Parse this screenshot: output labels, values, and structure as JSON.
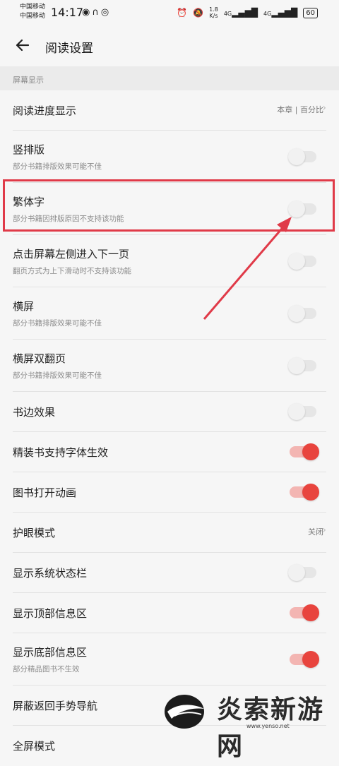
{
  "status_bar": {
    "carrier1": "中国移动",
    "carrier2": "中国移动",
    "time": "14:17",
    "net_speed_value": "1.8",
    "net_speed_unit": "K/s",
    "signal1": "4G",
    "signal2": "4G",
    "battery": "60",
    "left_icons": [
      "weibo-icon",
      "headphones-icon",
      "eye-icon"
    ],
    "right_icons": [
      "alarm-icon",
      "mute-icon"
    ]
  },
  "header": {
    "title": "阅读设置"
  },
  "section": {
    "label": "屏幕显示"
  },
  "rows": [
    {
      "title": "阅读进度显示",
      "value": "本章 | 百分比",
      "type": "nav"
    },
    {
      "title": "竖排版",
      "subtitle": "部分书籍排版效果可能不佳",
      "type": "toggle",
      "on": false
    },
    {
      "title": "繁体字",
      "subtitle": "部分书籍因排版原因不支持该功能",
      "type": "toggle",
      "on": false
    },
    {
      "title": "点击屏幕左侧进入下一页",
      "subtitle": "翻页方式为上下滑动时不支持该功能",
      "type": "toggle",
      "on": false
    },
    {
      "title": "横屏",
      "subtitle": "部分书籍排版效果可能不佳",
      "type": "toggle",
      "on": false
    },
    {
      "title": "横屏双翻页",
      "subtitle": "部分书籍排版效果可能不佳",
      "type": "toggle",
      "on": false
    },
    {
      "title": "书边效果",
      "type": "toggle",
      "on": false
    },
    {
      "title": "精装书支持字体生效",
      "type": "toggle",
      "on": true
    },
    {
      "title": "图书打开动画",
      "type": "toggle",
      "on": true
    },
    {
      "title": "护眼模式",
      "value": "关闭",
      "type": "nav"
    },
    {
      "title": "显示系统状态栏",
      "type": "toggle",
      "on": false
    },
    {
      "title": "显示顶部信息区",
      "type": "toggle",
      "on": true
    },
    {
      "title": "显示底部信息区",
      "subtitle": "部分精品图书不生效",
      "type": "toggle",
      "on": true
    },
    {
      "title": "屏蔽返回手势导航",
      "type": "plain"
    },
    {
      "title": "全屏模式",
      "type": "plain"
    }
  ],
  "watermark": {
    "text": "炎索新游网",
    "url": "www.yenso.net"
  },
  "colors": {
    "accent": "#e8443e",
    "annotation": "#e03a48"
  }
}
